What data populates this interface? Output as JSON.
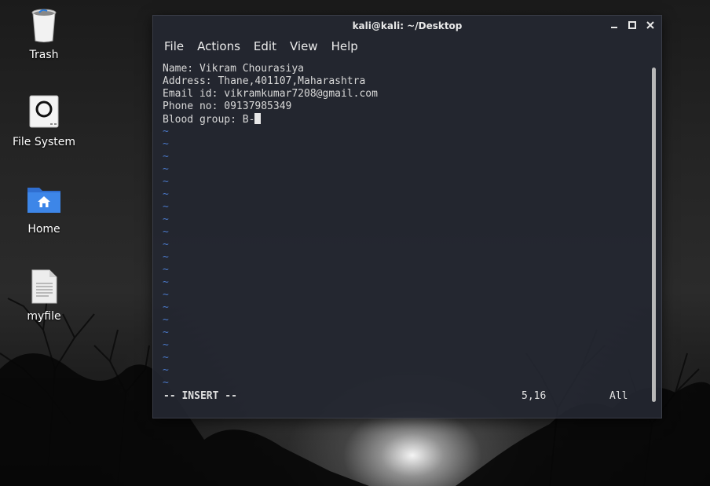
{
  "desktop": {
    "icons": [
      {
        "label": "Trash",
        "icon": "trash-icon"
      },
      {
        "label": "File System",
        "icon": "drive-icon"
      },
      {
        "label": "Home",
        "icon": "home-folder-icon"
      },
      {
        "label": "myfile",
        "icon": "text-file-icon"
      }
    ]
  },
  "window": {
    "title": "kali@kali: ~/Desktop",
    "controls": {
      "minimize": "minimize-icon",
      "maximize": "maximize-icon",
      "close": "close-icon"
    },
    "menu": [
      "File",
      "Actions",
      "Edit",
      "View",
      "Help"
    ]
  },
  "editor": {
    "lines": [
      "Name: Vikram Chourasiya",
      "Address: Thane,401107,Maharashtra",
      "Email id: vikramkumar7208@gmail.com",
      "Phone no: 09137985349",
      "Blood group: B-"
    ],
    "tilde": "~",
    "tilde_count": 21,
    "status": {
      "mode": "-- INSERT --",
      "position": "5,16",
      "scroll": "All"
    }
  },
  "colors": {
    "tilde": "#4a78c8",
    "terminal_bg": "#242730",
    "folder_blue": "#3d7fe0"
  }
}
